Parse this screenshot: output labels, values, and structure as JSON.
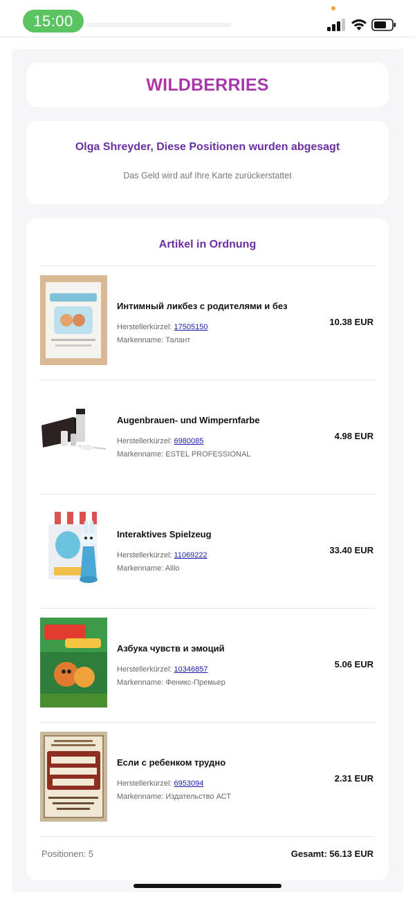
{
  "status_bar": {
    "time": "15:00",
    "accent": "#5cc362"
  },
  "logo": {
    "text": "WILDBERRIES",
    "color": "#b32db4"
  },
  "message": {
    "title": "Olga Shreyder, Diese Positionen wurden abgesagt",
    "subtitle": "Das Geld wird auf Ihre Karte zurückerstattet"
  },
  "items_section": {
    "title": "Artikel in Ordnung",
    "article_label": "Herstellerkürzel:",
    "brand_label": "Markenname:",
    "items": [
      {
        "name": "Интимный ликбез с родителями и без",
        "article": "17505150",
        "brand": "Талант",
        "price": "10.38 EUR",
        "image_icon": "book-cover-icon"
      },
      {
        "name": "Augenbrauen- und Wimpernfarbe",
        "article": "6980085",
        "brand": "ESTEL PROFESSIONAL",
        "price": "4.98 EUR",
        "image_icon": "cosmetics-kit-icon"
      },
      {
        "name": "Interaktives Spielzeug",
        "article": "11069222",
        "brand": "Alilo",
        "price": "33.40 EUR",
        "image_icon": "toy-bunny-icon"
      },
      {
        "name": "Азбука чувств и эмоций",
        "article": "10346857",
        "brand": "Феникс-Премьер",
        "price": "5.06 EUR",
        "image_icon": "book-cover-icon"
      },
      {
        "name": "Если с ребенком трудно",
        "article": "6953094",
        "brand": "Издательство АСТ",
        "price": "2.31 EUR",
        "image_icon": "book-cover-icon"
      }
    ],
    "footer": {
      "count": "Positionen: 5",
      "total": "Gesamt: 56.13 EUR"
    }
  }
}
